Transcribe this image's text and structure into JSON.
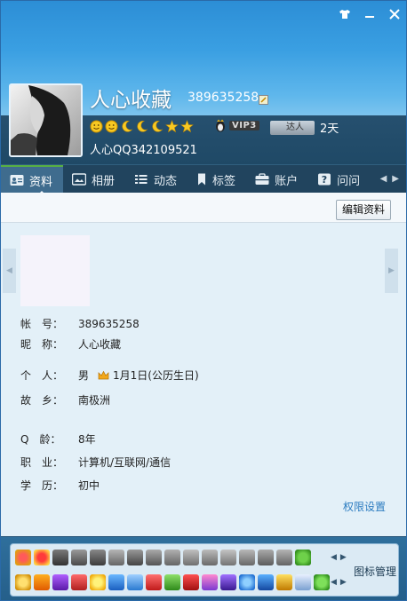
{
  "titlebar": {
    "skin_icon": "shirt-icon",
    "minimize_icon": "minimize-icon",
    "close_icon": "close-icon"
  },
  "profile": {
    "nickname": "人心收藏",
    "qq_number": "389635258",
    "vip_label": "VIP3",
    "daren_label": "达人",
    "daren_days": "2天",
    "signature": "人心QQ342109521"
  },
  "tabs": [
    {
      "label": "资料",
      "icon": "profile-card-icon"
    },
    {
      "label": "相册",
      "icon": "photo-album-icon"
    },
    {
      "label": "动态",
      "icon": "feed-list-icon"
    },
    {
      "label": "标签",
      "icon": "bookmark-tag-icon"
    },
    {
      "label": "账户",
      "icon": "wallet-icon"
    },
    {
      "label": "问问",
      "icon": "question-icon"
    }
  ],
  "toolbar": {
    "edit_label": "编辑资料"
  },
  "fields": {
    "account": {
      "label": "帐　号：",
      "value": "389635258"
    },
    "nickname": {
      "label": "昵　称：",
      "value": "人心收藏"
    },
    "personal": {
      "label": "个　人：",
      "gender": "男",
      "birthday": "1月1日(公历生日)"
    },
    "hometown": {
      "label": "故　乡：",
      "value": "南极洲"
    },
    "qage": {
      "label": "Q　龄：",
      "value": "8年"
    },
    "job": {
      "label": "职　业：",
      "value": "计算机/互联网/通信"
    },
    "education": {
      "label": "学　历：",
      "value": "初中"
    }
  },
  "permission_link": "权限设置",
  "icon_manager_label": "图标管理",
  "colors": {
    "header_top": "#2c8ed6",
    "tab_bar": "#21445e",
    "active_tab_accent": "#58b043",
    "content_bg": "#e3f0f8",
    "link": "#2b7bc0"
  }
}
